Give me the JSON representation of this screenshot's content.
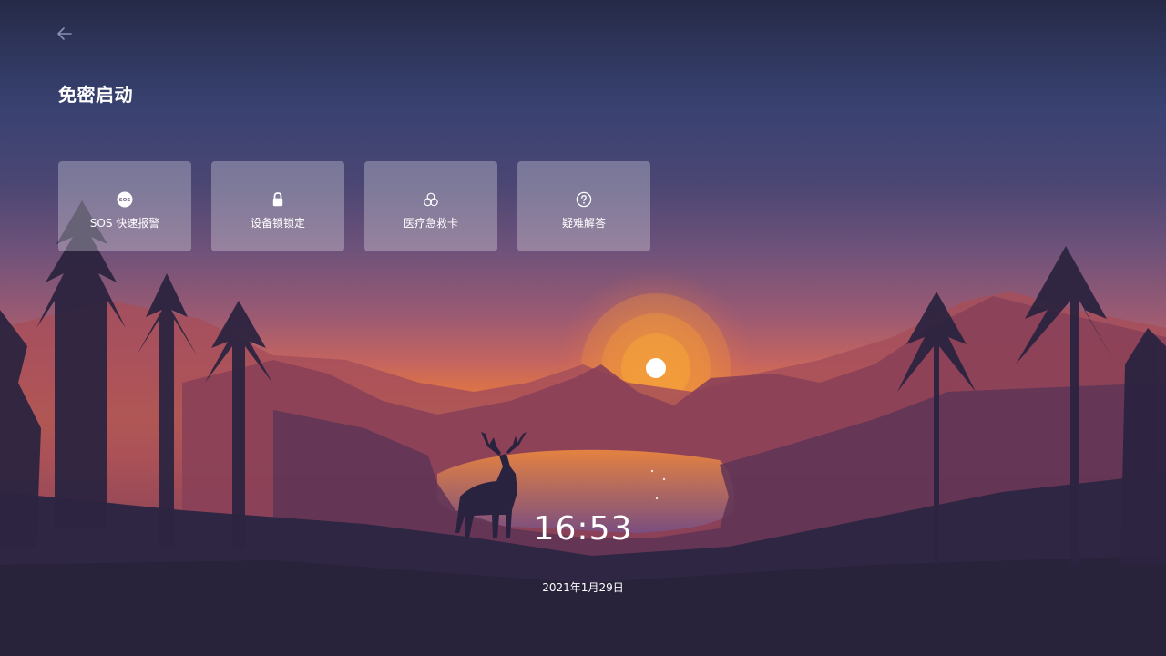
{
  "header": {
    "title": "免密启动"
  },
  "cards": [
    {
      "label": "SOS 快速报警",
      "icon": "sos-icon"
    },
    {
      "label": "设备锁锁定",
      "icon": "lock-icon"
    },
    {
      "label": "医疗急救卡",
      "icon": "biohazard-icon"
    },
    {
      "label": "疑难解答",
      "icon": "help-circle-icon"
    }
  ],
  "clock": {
    "time": "16:53",
    "date": "2021年1月29日"
  },
  "colors": {
    "text": "#ffffff",
    "card_bg": "rgba(255,255,255,0.28)",
    "sun": "#ffffff"
  }
}
